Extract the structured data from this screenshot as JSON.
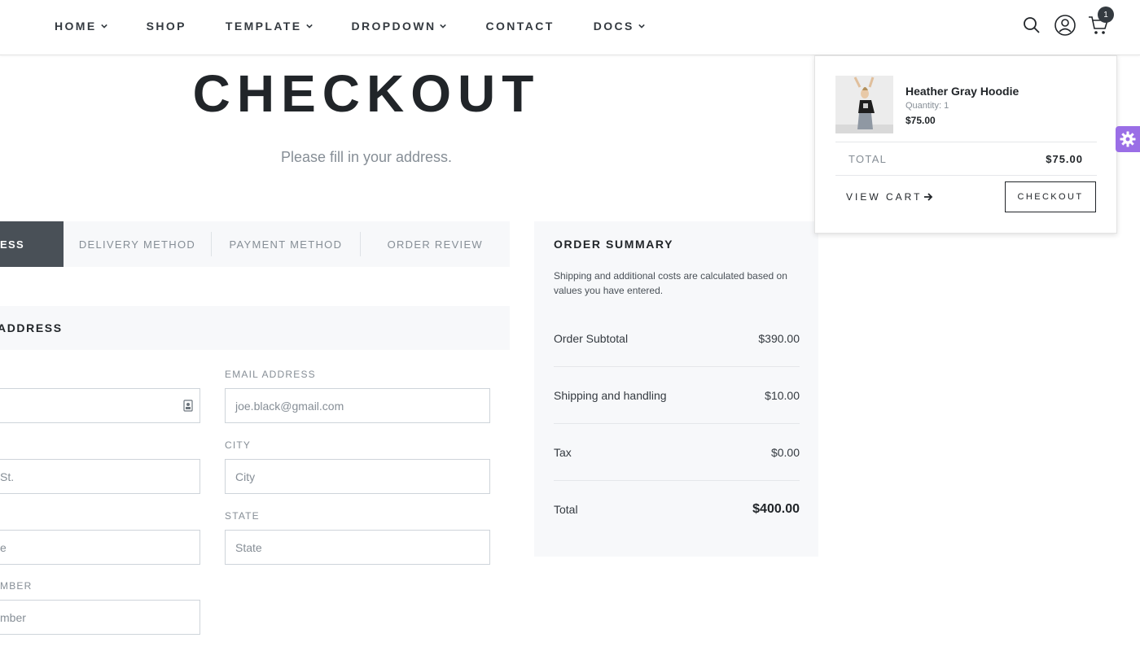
{
  "nav": {
    "items": [
      {
        "label": "HOME",
        "has_dropdown": true
      },
      {
        "label": "SHOP",
        "has_dropdown": false
      },
      {
        "label": "TEMPLATE",
        "has_dropdown": true
      },
      {
        "label": "DROPDOWN",
        "has_dropdown": true
      },
      {
        "label": "CONTACT",
        "has_dropdown": false
      },
      {
        "label": "DOCS",
        "has_dropdown": true
      }
    ],
    "cart_count": "1"
  },
  "hero": {
    "title": "CHECKOUT",
    "subtitle": "Please fill in your address."
  },
  "steps": {
    "active": "ESS",
    "delivery": "DELIVERY METHOD",
    "payment": "PAYMENT METHOD",
    "review": "ORDER REVIEW"
  },
  "address": {
    "heading": "ADDRESS",
    "email_label": "EMAIL ADDRESS",
    "email_placeholder": "joe.black@gmail.com",
    "street_placeholder": "St.",
    "city_label": "CITY",
    "city_placeholder": "City",
    "left3_placeholder": "e",
    "state_label": "STATE",
    "state_placeholder": "State",
    "phone_label": "MBER",
    "phone_placeholder": "mber"
  },
  "summary": {
    "title": "ORDER SUMMARY",
    "note": "Shipping and additional costs are calculated based on values you have entered.",
    "rows": [
      {
        "label": "Order Subtotal",
        "value": "$390.00"
      },
      {
        "label": "Shipping and handling",
        "value": "$10.00"
      },
      {
        "label": "Tax",
        "value": "$0.00"
      }
    ],
    "total_label": "Total",
    "total_value": "$400.00"
  },
  "cart": {
    "item_name": "Heather Gray Hoodie",
    "item_qty": "Quantity: 1",
    "item_price": "$75.00",
    "total_label": "TOTAL",
    "total_value": "$75.00",
    "view_cart": "VIEW CART",
    "checkout": "CHECKOUT"
  },
  "colors": {
    "accent_gear": "#9a6ee6",
    "active_step": "#495057"
  }
}
